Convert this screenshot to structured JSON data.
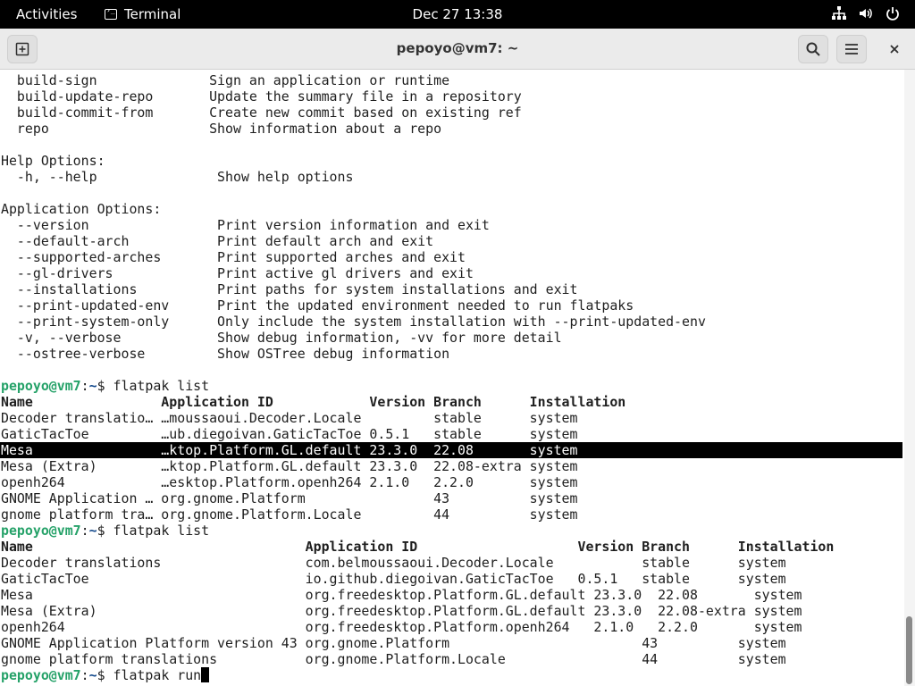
{
  "topbar": {
    "activities": "Activities",
    "app_name": "Terminal",
    "clock": "Dec 27  13:38",
    "tray_icons": [
      "network-icon",
      "volume-icon",
      "power-icon"
    ]
  },
  "window": {
    "title": "pepoyo@vm7: ~",
    "new_tab_icon": "new-tab-icon",
    "search_icon": "search-icon",
    "menu_icon": "hamburger-menu-icon",
    "close_icon": "close-icon"
  },
  "terminal": {
    "lines": [
      {
        "t": "  build-sign              Sign an application or runtime"
      },
      {
        "t": "  build-update-repo       Update the summary file in a repository"
      },
      {
        "t": "  build-commit-from       Create new commit based on existing ref"
      },
      {
        "t": "  repo                    Show information about a repo"
      },
      {
        "t": ""
      },
      {
        "t": "Help Options:"
      },
      {
        "t": "  -h, --help               Show help options"
      },
      {
        "t": ""
      },
      {
        "t": "Application Options:"
      },
      {
        "t": "  --version                Print version information and exit"
      },
      {
        "t": "  --default-arch           Print default arch and exit"
      },
      {
        "t": "  --supported-arches       Print supported arches and exit"
      },
      {
        "t": "  --gl-drivers             Print active gl drivers and exit"
      },
      {
        "t": "  --installations          Print paths for system installations and exit"
      },
      {
        "t": "  --print-updated-env      Print the updated environment needed to run flatpaks"
      },
      {
        "t": "  --print-system-only      Only include the system installation with --print-updated-env"
      },
      {
        "t": "  -v, --verbose            Show debug information, -vv for more detail"
      },
      {
        "t": "  --ostree-verbose         Show OSTree debug information"
      },
      {
        "t": ""
      },
      {
        "kind": "prompt",
        "user": "pepoyo@vm7",
        "sep": ":",
        "path": "~",
        "cmd": "$ flatpak list"
      },
      {
        "kind": "bold",
        "t": "Name                Application ID            Version Branch      Installation"
      },
      {
        "t": "Decoder translatio… …moussaoui.Decoder.Locale         stable      system"
      },
      {
        "t": "GaticTacToe         …ub.diegoivan.GaticTacToe 0.5.1   stable      system"
      },
      {
        "kind": "selected",
        "t": "Mesa                …ktop.Platform.GL.default 23.3.0  22.08       system"
      },
      {
        "t": "Mesa (Extra)        …ktop.Platform.GL.default 23.3.0  22.08-extra system"
      },
      {
        "t": "openh264            …esktop.Platform.openh264 2.1.0   2.2.0       system"
      },
      {
        "t": "GNOME Application … org.gnome.Platform                43          system"
      },
      {
        "t": "gnome platform tra… org.gnome.Platform.Locale         44          system"
      },
      {
        "kind": "prompt",
        "user": "pepoyo@vm7",
        "sep": ":",
        "path": "~",
        "cmd": "$ flatpak list"
      },
      {
        "kind": "bold",
        "t": "Name                                  Application ID                    Version Branch      Installation"
      },
      {
        "t": "Decoder translations                  com.belmoussaoui.Decoder.Locale           stable      system"
      },
      {
        "t": "GaticTacToe                           io.github.diegoivan.GaticTacToe   0.5.1   stable      system"
      },
      {
        "t": "Mesa                                  org.freedesktop.Platform.GL.default 23.3.0  22.08       system"
      },
      {
        "t": "Mesa (Extra)                          org.freedesktop.Platform.GL.default 23.3.0  22.08-extra system"
      },
      {
        "t": "openh264                              org.freedesktop.Platform.openh264   2.1.0   2.2.0       system"
      },
      {
        "t": "GNOME Application Platform version 43 org.gnome.Platform                        43          system"
      },
      {
        "t": "gnome platform translations           org.gnome.Platform.Locale                 44          system"
      },
      {
        "kind": "prompt",
        "user": "pepoyo@vm7",
        "sep": ":",
        "path": "~",
        "cmd": "$ flatpak run",
        "cursor": true
      }
    ]
  }
}
